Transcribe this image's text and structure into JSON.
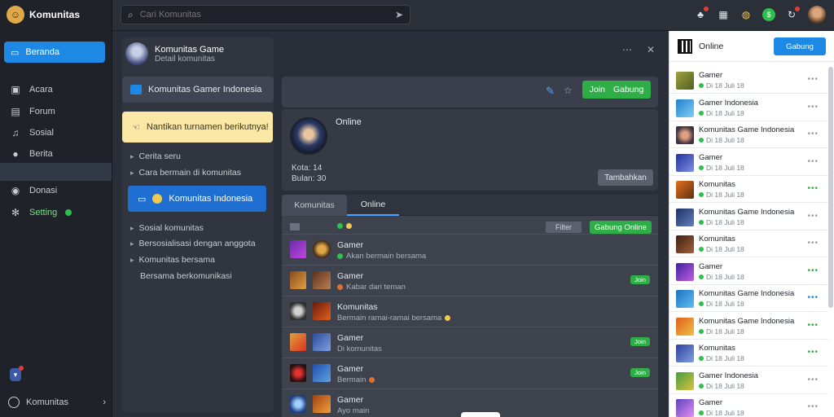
{
  "app": {
    "name": "Komunitas"
  },
  "sidebar": {
    "primary": "Beranda",
    "items": [
      {
        "label": "Acara",
        "icon": "calendar-icon"
      },
      {
        "label": "Forum",
        "icon": "forum-icon"
      },
      {
        "label": "Sosial",
        "icon": "music-icon"
      },
      {
        "label": "Berita",
        "icon": "chat-icon"
      },
      {
        "label": "Donasi",
        "icon": "donate-icon"
      },
      {
        "label": "Setting",
        "icon": "gear-icon"
      }
    ],
    "footer": "Komunitas"
  },
  "search": {
    "placeholder": "Cari Komunitas"
  },
  "mid": {
    "title": "Komunitas Game",
    "subtitle": "Detail komunitas",
    "section": "Komunitas Gamer Indonesia",
    "note": "Nantikan turnamen berikutnya!",
    "links": [
      "Cerita seru",
      "Cara bermain di komunitas"
    ],
    "button": "Komunitas Indonesia",
    "links2": [
      "Sosial komunitas",
      "Bersosialisasi dengan anggota",
      "Komunitas bersama",
      "Bersama berkomunikasi"
    ]
  },
  "main": {
    "join_label": "Join",
    "join_label2": "Gabung",
    "status": "Online",
    "meta": [
      "Kota: 14",
      "Bulan: 30"
    ],
    "profile_button": "Tambahkan",
    "tabs": [
      "Komunitas",
      "Online"
    ],
    "filter": "Filter",
    "toolbar_button": "Gabung Online",
    "mini_label": "Join",
    "rows": [
      {
        "name": "Gamer",
        "sub": "Akan bermain bersama"
      },
      {
        "name": "Gamer",
        "sub": "Kabar dari teman"
      },
      {
        "name": "Komunitas",
        "sub": "Bermain ramai-ramai bersama"
      },
      {
        "name": "Gamer",
        "sub": "Di komunitas"
      },
      {
        "name": "Gamer",
        "sub": "Bermain"
      },
      {
        "name": "Gamer",
        "sub": "Ayo main"
      }
    ]
  },
  "right": {
    "label": "Online",
    "button": "Gabung",
    "rows": [
      {
        "name": "Gamer",
        "sub": "Di 18 Juli 18"
      },
      {
        "name": "Gamer Indonesia",
        "sub": "Di 18 Juli 18"
      },
      {
        "name": "Komunitas Game Indonesia",
        "sub": "Di 18 Juli 18"
      },
      {
        "name": "Gamer",
        "sub": "Di 18 Juli 18"
      },
      {
        "name": "Komunitas",
        "sub": "Di 18 Juli 18"
      },
      {
        "name": "Komunitas Game Indonesia",
        "sub": "Di 18 Juli 18"
      },
      {
        "name": "Komunitas",
        "sub": "Di 18 Juli 18"
      },
      {
        "name": "Gamer",
        "sub": "Di 18 Juli 18"
      },
      {
        "name": "Komunitas Game Indonesia",
        "sub": "Di 18 Juli 18"
      },
      {
        "name": "Komunitas Game Indonesia",
        "sub": "Di 18 Juli 18"
      },
      {
        "name": "Komunitas",
        "sub": "Di 18 Juli 18"
      },
      {
        "name": "Gamer Indonesia",
        "sub": "Di 18 Juli 18"
      },
      {
        "name": "Gamer",
        "sub": "Di 18 Juli 18"
      }
    ]
  },
  "colors": {
    "accent": "#1e88e5",
    "success": "#2fae47",
    "note": "#fbe8a6"
  }
}
